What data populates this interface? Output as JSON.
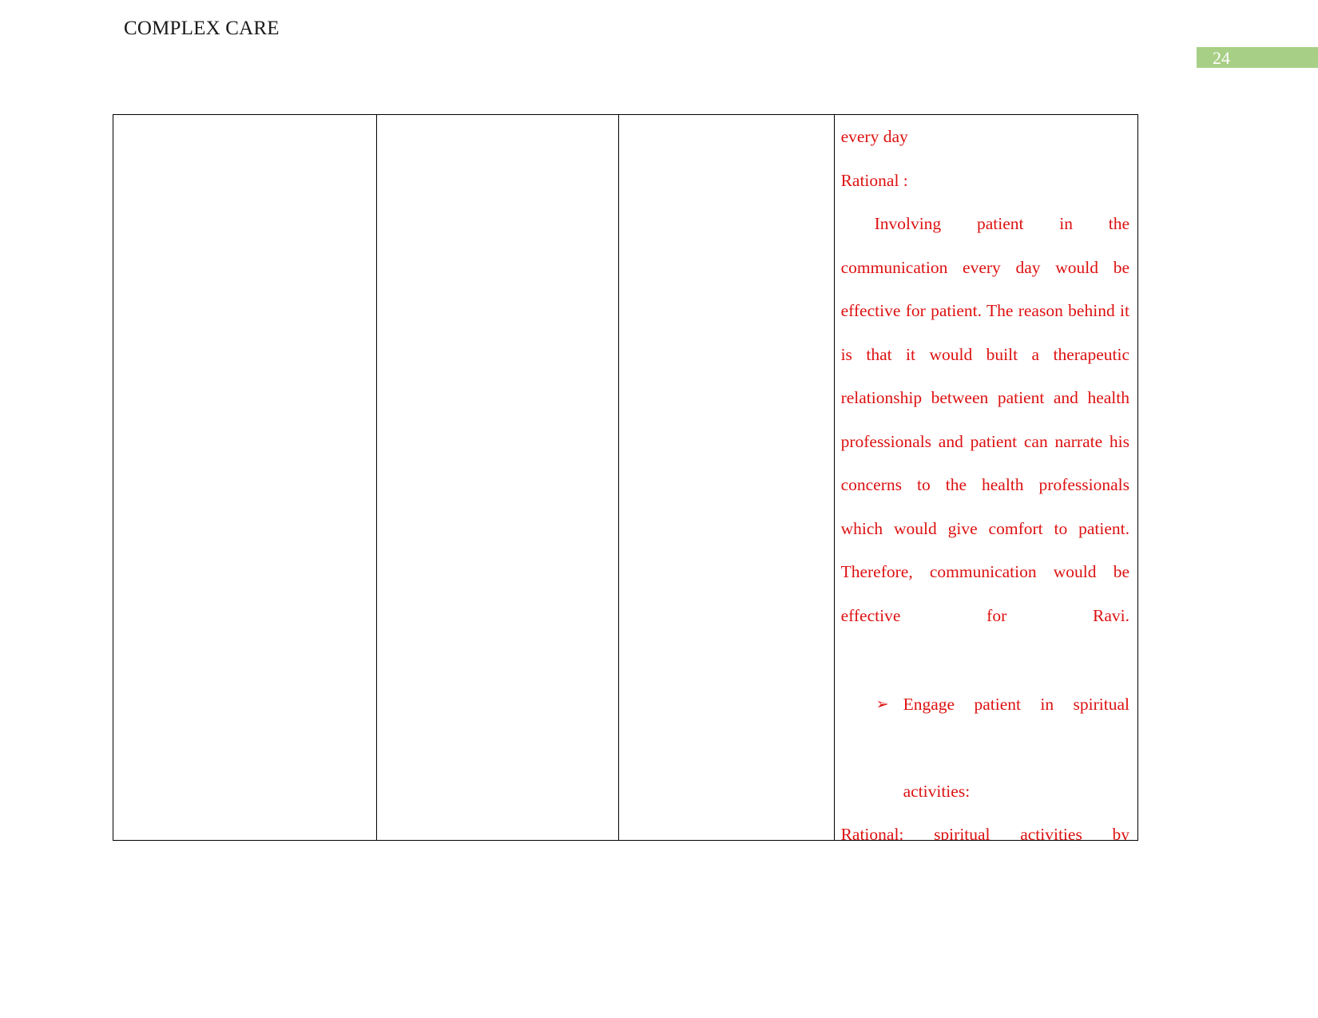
{
  "document": {
    "header_title": "COMPLEX CARE",
    "page_number": "24",
    "accent_color": "#a8cf86",
    "body_text_color": "#dd1111"
  },
  "table": {
    "columns": [
      {
        "name": "column-1",
        "content": ""
      },
      {
        "name": "column-2",
        "content": ""
      },
      {
        "name": "column-3",
        "content": ""
      },
      {
        "name": "column-4",
        "content": "nursing-interventions-rationale"
      }
    ]
  },
  "cell": {
    "continued_line": "every day",
    "rational_heading": "Rational :",
    "rational_paragraph_lines": [
      "Involving patient in the",
      "communication every day would be",
      "effective for patient. The reason",
      "behind it is  that it would built a",
      "therapeutic relationship between",
      "patient and health professionals and",
      "patient can narrate his concerns to the",
      "health professionals which would",
      "give comfort to  patient.  Therefore,",
      "communication would be effective",
      "for Ravi."
    ],
    "rational_paragraph": "Involving patient in the communication every day would be effective for patient. The reason behind it is  that it would built a therapeutic relationship between patient and health professionals and patient can narrate his concerns to the health professionals which would give comfort to  patient.  Therefore, communication would be effective for Ravi.",
    "bullet_marker": "➢",
    "bullet_text": "Engage patient in spiritual activities:",
    "bullet_line_1": "Engage patient in spiritual",
    "bullet_line_2": "activities:",
    "trailing_clipped_line": "Rational:    spiritual    activities    by"
  }
}
